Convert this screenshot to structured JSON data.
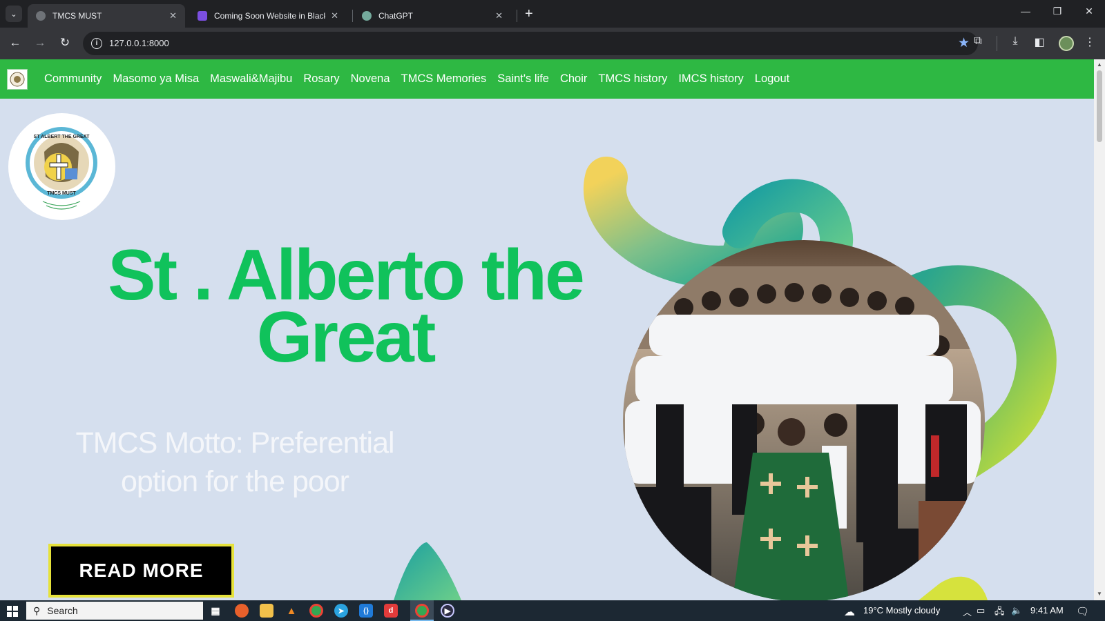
{
  "browser": {
    "tabs": [
      {
        "title": "TMCS MUST",
        "active": true
      },
      {
        "title": "Coming Soon Website in Black",
        "active": false
      },
      {
        "title": "ChatGPT",
        "active": false
      }
    ],
    "address": "127.0.0.1:8000"
  },
  "site": {
    "nav": [
      "Community",
      "Masomo ya Misa",
      "Maswali&Majibu",
      "Rosary",
      "Novena",
      "TMCS Memories",
      "Saint's life",
      "Choir",
      "TMCS history",
      "IMCS history",
      "Logout"
    ],
    "hero_title_line1": "St . Alberto the",
    "hero_title_line2": "Great",
    "motto_line1": "TMCS Motto: Preferential",
    "motto_line2": "option for the poor",
    "read_more": "READ MORE",
    "logo_ring_top": "ST ALBERT THE GREAT",
    "logo_ring_bottom": "TMCS MUST",
    "colors": {
      "nav": "#2eb843",
      "title": "#10c25b",
      "page_bg": "#d5dfee",
      "button_border": "#e6e23b"
    }
  },
  "taskbar": {
    "search_placeholder": "Search",
    "weather": "19°C  Mostly cloudy",
    "time": "9:41 AM"
  }
}
